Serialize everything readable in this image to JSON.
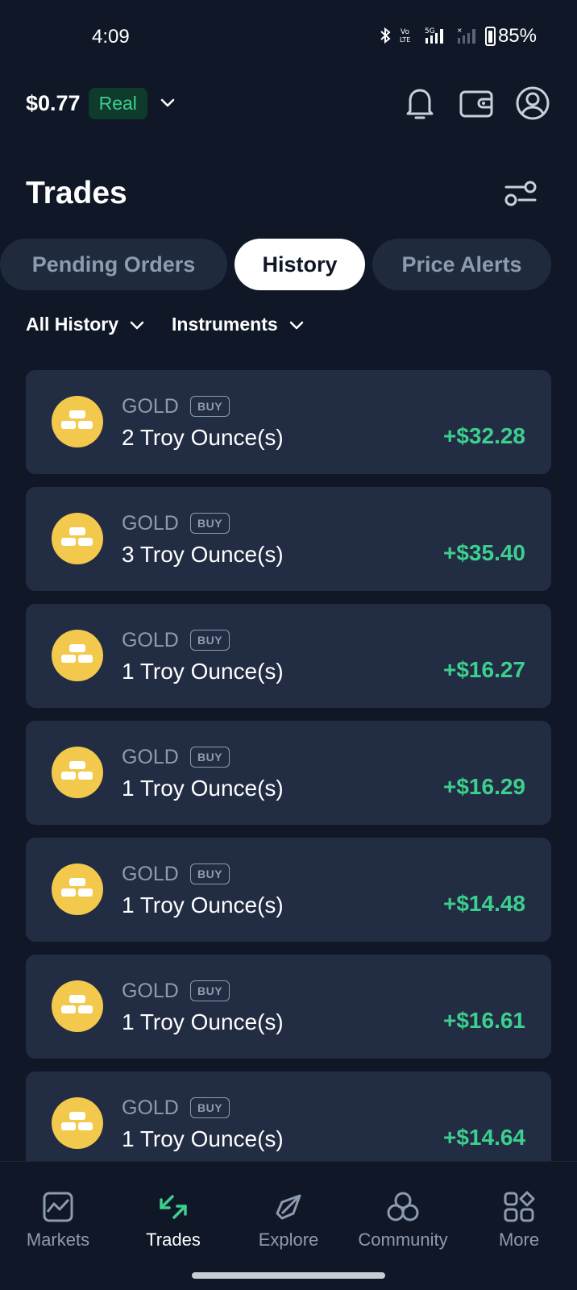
{
  "status_bar": {
    "time": "4:09",
    "network": "5G",
    "battery": "85%"
  },
  "header": {
    "balance": "$0.77",
    "account_type": "Real"
  },
  "page": {
    "title": "Trades"
  },
  "tabs": [
    {
      "label": "Pending Orders",
      "active": false
    },
    {
      "label": "History",
      "active": true
    },
    {
      "label": "Price Alerts",
      "active": false
    }
  ],
  "filters": {
    "history": "All History",
    "instruments": "Instruments"
  },
  "trades": [
    {
      "instrument": "GOLD",
      "side": "BUY",
      "quantity": "2 Troy Ounce(s)",
      "pnl": "+$32.28"
    },
    {
      "instrument": "GOLD",
      "side": "BUY",
      "quantity": "3 Troy Ounce(s)",
      "pnl": "+$35.40"
    },
    {
      "instrument": "GOLD",
      "side": "BUY",
      "quantity": "1 Troy Ounce(s)",
      "pnl": "+$16.27"
    },
    {
      "instrument": "GOLD",
      "side": "BUY",
      "quantity": "1 Troy Ounce(s)",
      "pnl": "+$16.29"
    },
    {
      "instrument": "GOLD",
      "side": "BUY",
      "quantity": "1 Troy Ounce(s)",
      "pnl": "+$14.48"
    },
    {
      "instrument": "GOLD",
      "side": "BUY",
      "quantity": "1 Troy Ounce(s)",
      "pnl": "+$16.61"
    },
    {
      "instrument": "GOLD",
      "side": "BUY",
      "quantity": "1 Troy Ounce(s)",
      "pnl": "+$14.64"
    }
  ],
  "bottom_nav": [
    {
      "label": "Markets",
      "icon": "chart-icon",
      "active": false
    },
    {
      "label": "Trades",
      "icon": "trades-arrows-icon",
      "active": true
    },
    {
      "label": "Explore",
      "icon": "compass-icon",
      "active": false
    },
    {
      "label": "Community",
      "icon": "community-icon",
      "active": false
    },
    {
      "label": "More",
      "icon": "grid-icon",
      "active": false
    }
  ],
  "colors": {
    "background": "#101828",
    "card": "#222d44",
    "positive": "#3ccf8e",
    "coin": "#f2c94c",
    "muted": "#8d9bb0"
  }
}
